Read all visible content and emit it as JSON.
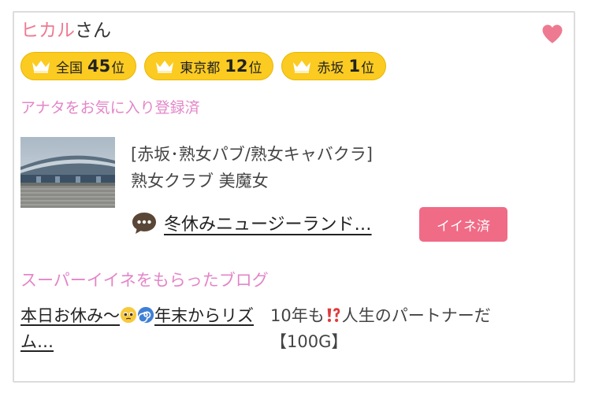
{
  "profile": {
    "name": "ヒカル",
    "suffix": "さん"
  },
  "favorite_icon": "heart-icon",
  "colors": {
    "accent_pink": "#ee7a92",
    "label_pink": "#e386c8",
    "badge_yellow": "#fbcb22",
    "button_pink": "#f06b86"
  },
  "rankings": [
    {
      "area": "全国",
      "rank": "45",
      "unit": "位"
    },
    {
      "area": "東京都",
      "rank": "12",
      "unit": "位"
    },
    {
      "area": "赤坂",
      "rank": "1",
      "unit": "位"
    }
  ],
  "favorited_text": "アナタをお気に入り登録済",
  "shop": {
    "category": "[赤坂･熟女パブ/熟女キャバクラ]",
    "name": "熟女クラブ 美魔女"
  },
  "liked_blog": {
    "title": "冬休みニュージーランド…",
    "like_button": "イイネ済"
  },
  "super_like_heading": "スーパーイイネをもらったブログ",
  "super_blogs": [
    {
      "part1": "本日お休み〜",
      "emoji1": "pleading-face-icon",
      "emoji2": "cyclone-icon",
      "part2": "年末からリズム…"
    },
    {
      "part1": "10年も",
      "emoji1": "exclamation-question-icon",
      "part2": "人生のパートナーだ【100G】"
    }
  ]
}
